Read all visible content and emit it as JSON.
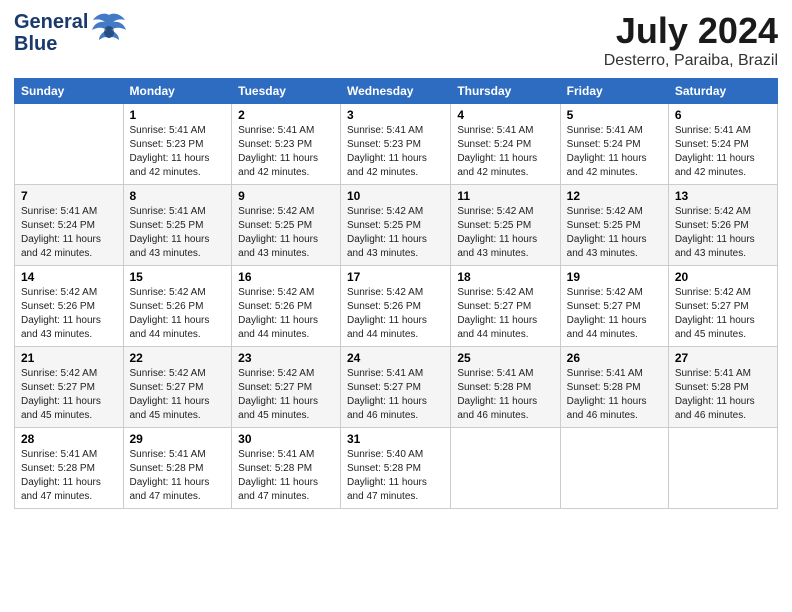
{
  "header": {
    "logo_line1": "General",
    "logo_line2": "Blue",
    "title": "July 2024",
    "subtitle": "Desterro, Paraiba, Brazil"
  },
  "days_of_week": [
    "Sunday",
    "Monday",
    "Tuesday",
    "Wednesday",
    "Thursday",
    "Friday",
    "Saturday"
  ],
  "weeks": [
    [
      {
        "day": "",
        "info": ""
      },
      {
        "day": "1",
        "info": "Sunrise: 5:41 AM\nSunset: 5:23 PM\nDaylight: 11 hours\nand 42 minutes."
      },
      {
        "day": "2",
        "info": "Sunrise: 5:41 AM\nSunset: 5:23 PM\nDaylight: 11 hours\nand 42 minutes."
      },
      {
        "day": "3",
        "info": "Sunrise: 5:41 AM\nSunset: 5:23 PM\nDaylight: 11 hours\nand 42 minutes."
      },
      {
        "day": "4",
        "info": "Sunrise: 5:41 AM\nSunset: 5:24 PM\nDaylight: 11 hours\nand 42 minutes."
      },
      {
        "day": "5",
        "info": "Sunrise: 5:41 AM\nSunset: 5:24 PM\nDaylight: 11 hours\nand 42 minutes."
      },
      {
        "day": "6",
        "info": "Sunrise: 5:41 AM\nSunset: 5:24 PM\nDaylight: 11 hours\nand 42 minutes."
      }
    ],
    [
      {
        "day": "7",
        "info": "Sunrise: 5:41 AM\nSunset: 5:24 PM\nDaylight: 11 hours\nand 42 minutes."
      },
      {
        "day": "8",
        "info": "Sunrise: 5:41 AM\nSunset: 5:25 PM\nDaylight: 11 hours\nand 43 minutes."
      },
      {
        "day": "9",
        "info": "Sunrise: 5:42 AM\nSunset: 5:25 PM\nDaylight: 11 hours\nand 43 minutes."
      },
      {
        "day": "10",
        "info": "Sunrise: 5:42 AM\nSunset: 5:25 PM\nDaylight: 11 hours\nand 43 minutes."
      },
      {
        "day": "11",
        "info": "Sunrise: 5:42 AM\nSunset: 5:25 PM\nDaylight: 11 hours\nand 43 minutes."
      },
      {
        "day": "12",
        "info": "Sunrise: 5:42 AM\nSunset: 5:25 PM\nDaylight: 11 hours\nand 43 minutes."
      },
      {
        "day": "13",
        "info": "Sunrise: 5:42 AM\nSunset: 5:26 PM\nDaylight: 11 hours\nand 43 minutes."
      }
    ],
    [
      {
        "day": "14",
        "info": "Sunrise: 5:42 AM\nSunset: 5:26 PM\nDaylight: 11 hours\nand 43 minutes."
      },
      {
        "day": "15",
        "info": "Sunrise: 5:42 AM\nSunset: 5:26 PM\nDaylight: 11 hours\nand 44 minutes."
      },
      {
        "day": "16",
        "info": "Sunrise: 5:42 AM\nSunset: 5:26 PM\nDaylight: 11 hours\nand 44 minutes."
      },
      {
        "day": "17",
        "info": "Sunrise: 5:42 AM\nSunset: 5:26 PM\nDaylight: 11 hours\nand 44 minutes."
      },
      {
        "day": "18",
        "info": "Sunrise: 5:42 AM\nSunset: 5:27 PM\nDaylight: 11 hours\nand 44 minutes."
      },
      {
        "day": "19",
        "info": "Sunrise: 5:42 AM\nSunset: 5:27 PM\nDaylight: 11 hours\nand 44 minutes."
      },
      {
        "day": "20",
        "info": "Sunrise: 5:42 AM\nSunset: 5:27 PM\nDaylight: 11 hours\nand 45 minutes."
      }
    ],
    [
      {
        "day": "21",
        "info": "Sunrise: 5:42 AM\nSunset: 5:27 PM\nDaylight: 11 hours\nand 45 minutes."
      },
      {
        "day": "22",
        "info": "Sunrise: 5:42 AM\nSunset: 5:27 PM\nDaylight: 11 hours\nand 45 minutes."
      },
      {
        "day": "23",
        "info": "Sunrise: 5:42 AM\nSunset: 5:27 PM\nDaylight: 11 hours\nand 45 minutes."
      },
      {
        "day": "24",
        "info": "Sunrise: 5:41 AM\nSunset: 5:27 PM\nDaylight: 11 hours\nand 46 minutes."
      },
      {
        "day": "25",
        "info": "Sunrise: 5:41 AM\nSunset: 5:28 PM\nDaylight: 11 hours\nand 46 minutes."
      },
      {
        "day": "26",
        "info": "Sunrise: 5:41 AM\nSunset: 5:28 PM\nDaylight: 11 hours\nand 46 minutes."
      },
      {
        "day": "27",
        "info": "Sunrise: 5:41 AM\nSunset: 5:28 PM\nDaylight: 11 hours\nand 46 minutes."
      }
    ],
    [
      {
        "day": "28",
        "info": "Sunrise: 5:41 AM\nSunset: 5:28 PM\nDaylight: 11 hours\nand 47 minutes."
      },
      {
        "day": "29",
        "info": "Sunrise: 5:41 AM\nSunset: 5:28 PM\nDaylight: 11 hours\nand 47 minutes."
      },
      {
        "day": "30",
        "info": "Sunrise: 5:41 AM\nSunset: 5:28 PM\nDaylight: 11 hours\nand 47 minutes."
      },
      {
        "day": "31",
        "info": "Sunrise: 5:40 AM\nSunset: 5:28 PM\nDaylight: 11 hours\nand 47 minutes."
      },
      {
        "day": "",
        "info": ""
      },
      {
        "day": "",
        "info": ""
      },
      {
        "day": "",
        "info": ""
      }
    ]
  ]
}
